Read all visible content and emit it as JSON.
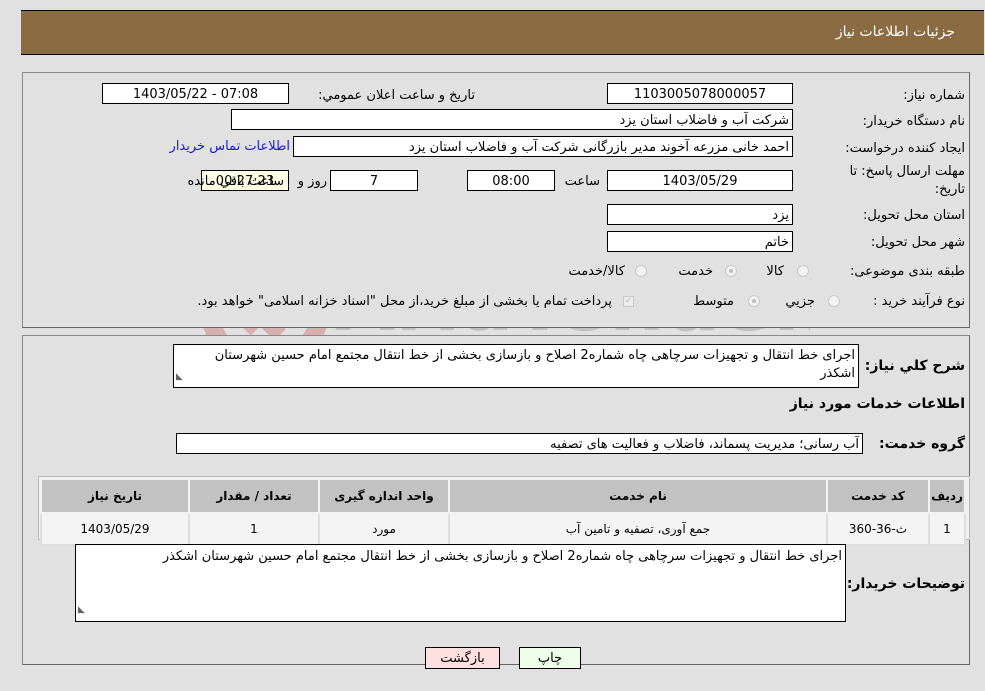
{
  "header": {
    "title": "جزئیات اطلاعات نیاز"
  },
  "form": {
    "need_number_label": "شماره نیاز:",
    "need_number": "1103005078000057",
    "announce_label": "تاریخ و ساعت اعلان عمومي:",
    "announce_value": "1403/05/22 - 07:08",
    "buyer_org_label": "نام دستگاه خریدار:",
    "buyer_org": "شرکت آب و فاضلاب استان یزد",
    "creator_label": "ایجاد کننده درخواست:",
    "creator": "احمد خانی مزرعه آخوند مدیر بازرگانی شرکت آب و فاضلاب استان یزد",
    "contact_link": "اطلاعات تماس خریدار",
    "deadline_label_1": "مهلت ارسال پاسخ: تا",
    "deadline_label_2": "تاریخ:",
    "deadline_date": "1403/05/29",
    "time_label": "ساعت",
    "deadline_time": "08:00",
    "days_value": "7",
    "days_label": "روز و",
    "remaining_time": "00:27:23",
    "remaining_label": "ساعت باقي مانده",
    "province_label": "استان محل تحویل:",
    "province": "یزد",
    "city_label": "شهر محل تحویل:",
    "city": "خاتم",
    "category_label": "طبقه بندی موضوعی:",
    "category_options": [
      {
        "label": "کالا",
        "selected": false
      },
      {
        "label": "خدمت",
        "selected": true
      },
      {
        "label": "کالا/خدمت",
        "selected": false
      }
    ],
    "process_label": "نوع فرآیند خرید :",
    "process_options": [
      {
        "label": "جزيي",
        "selected": false
      },
      {
        "label": "متوسط",
        "selected": true
      }
    ],
    "treasury_checkbox_label": "پرداخت تمام یا بخشی از مبلغ خرید،از محل \"اسناد خزانه اسلامی\" خواهد بود.",
    "treasury_checked": true
  },
  "details": {
    "summary_label": "شرح کلي نیاز:",
    "summary": "اجرای خط انتقال و تجهیزات سرچاهی چاه شماره2 اصلاح و بازسازی بخشی از خط انتقال مجتمع امام حسین شهرستان اشکذر",
    "services_heading": "اطلاعات خدمات مورد نیاز",
    "service_group_label": "گروه خدمت:",
    "service_group": "آب رسانی؛ مدیریت پسماند، فاضلاب و فعالیت های تصفیه",
    "table": {
      "headers": [
        "ردیف",
        "کد خدمت",
        "نام خدمت",
        "واحد اندازه گیری",
        "تعداد / مقدار",
        "تاریخ نیاز"
      ],
      "rows": [
        [
          "1",
          "ث-36-360",
          "جمع آوری، تصفیه و تامین آب",
          "مورد",
          "1",
          "1403/05/29"
        ]
      ]
    },
    "buyer_notes_label": "توضیحات خریدار:",
    "buyer_notes": "اجرای خط انتقال و تجهیزات سرچاهی چاه شماره2 اصلاح و بازسازی بخشی از خط انتقال مجتمع امام حسین شهرستان اشکذر"
  },
  "buttons": {
    "print": "چاپ",
    "back": "بازگشت"
  },
  "watermark": {
    "text": "AriaTender.neT"
  },
  "colors": {
    "header_bg": "#8b6b42",
    "print_bg": "#eefee9",
    "back_bg": "#ffe0e0",
    "link": "#1b1bd6"
  }
}
